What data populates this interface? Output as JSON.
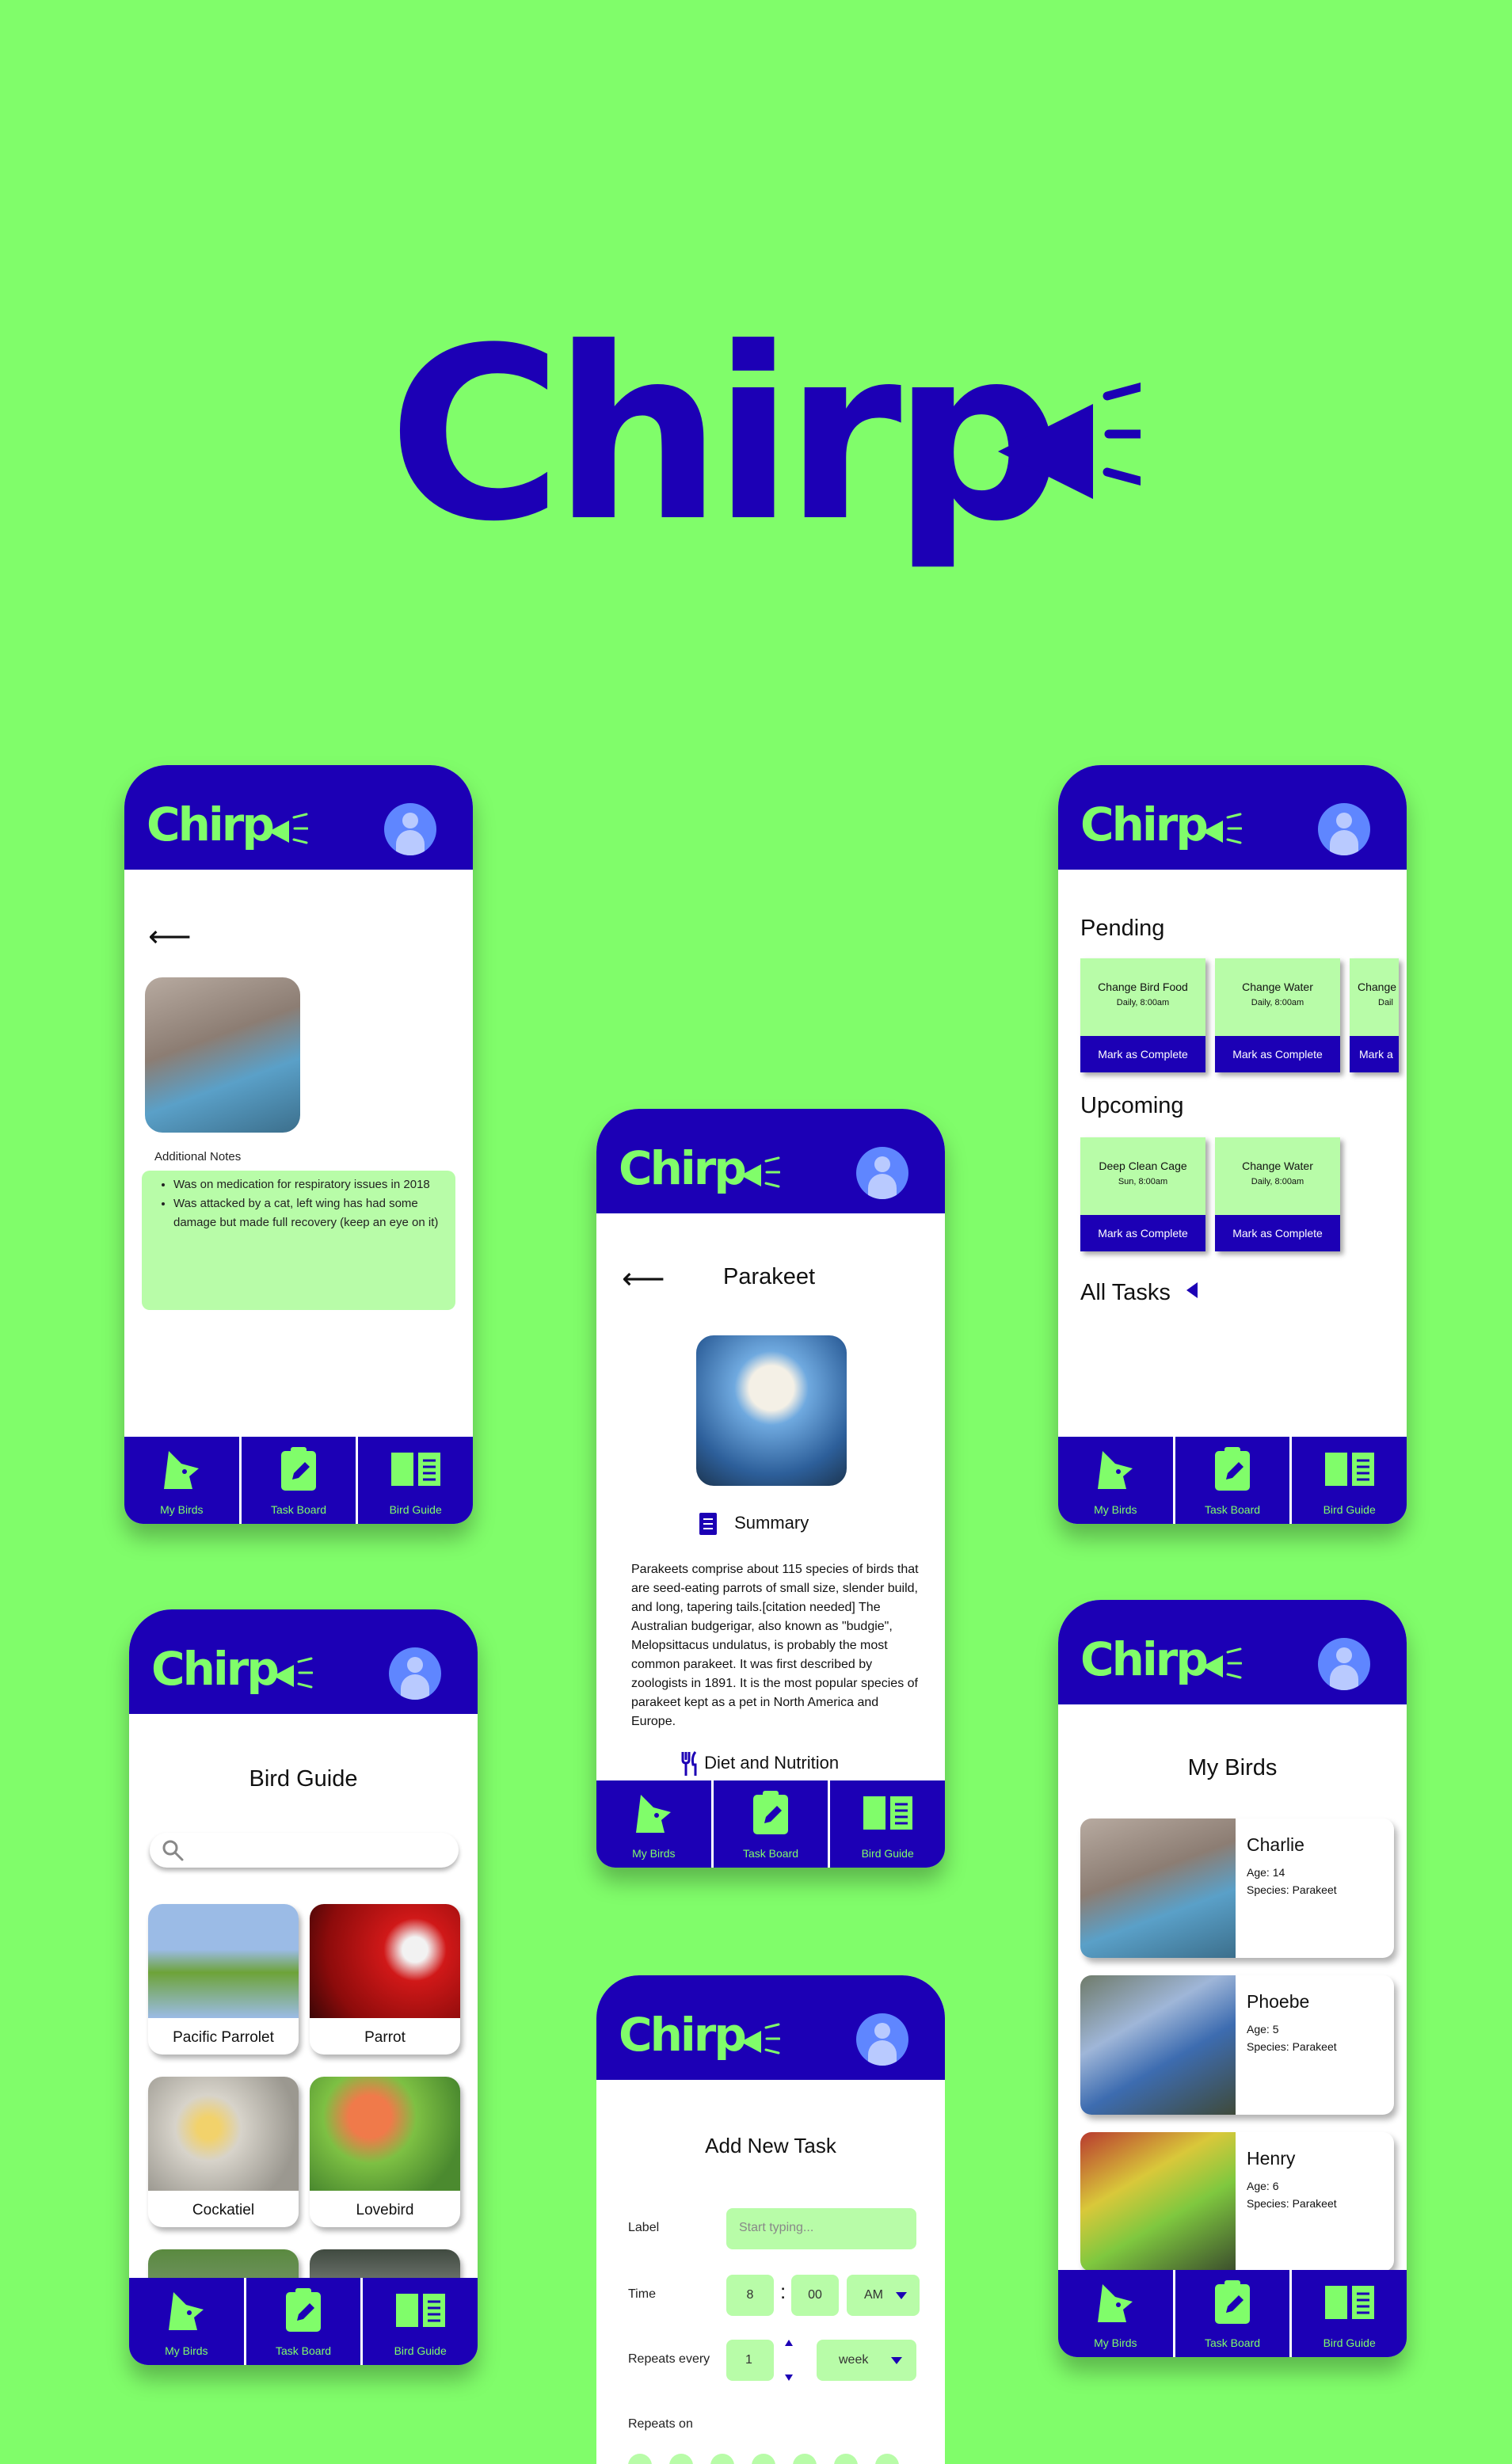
{
  "brand": {
    "name": "Chirp",
    "primary_color": "#1c00b5",
    "accent_color": "#80fd6a",
    "card_color": "#b8fca8"
  },
  "nav": {
    "my_birds": "My Birds",
    "task_board": "Task Board",
    "bird_guide": "Bird Guide"
  },
  "bird_detail": {
    "back_icon": "back-arrow-icon",
    "notes_title": "Additional Notes",
    "notes": [
      "Was on medication for respiratory issues in 2018",
      "Was attacked by a cat, left wing has had some damage but made full recovery (keep an eye on it)"
    ]
  },
  "task_board": {
    "pending_title": "Pending",
    "pending": [
      {
        "label": "Change Bird Food",
        "time": "Daily, 8:00am",
        "button": "Mark as Complete"
      },
      {
        "label": "Change Water",
        "time": "Daily, 8:00am",
        "button": "Mark as Complete"
      },
      {
        "label": "Change",
        "time": "Dail",
        "button": "Mark a"
      }
    ],
    "upcoming_title": "Upcoming",
    "upcoming": [
      {
        "label": "Deep Clean Cage",
        "time": "Sun, 8:00am",
        "button": "Mark as Complete"
      },
      {
        "label": "Change Water",
        "time": "Daily, 8:00am",
        "button": "Mark as Complete"
      }
    ],
    "all_tasks_label": "All Tasks"
  },
  "species_page": {
    "title": "Parakeet",
    "summary_title": "Summary",
    "summary_text": "Parakeets comprise about 115 species of birds that are seed-eating parrots of small size, slender build, and long, tapering tails.[citation needed] The Australian budgerigar, also known as \"budgie\", Melopsittacus undulatus, is probably the most common parakeet. It was first described by zoologists in 1891. It is the most popular species of parakeet kept as a pet in North America and Europe.",
    "diet_title": "Diet and Nutrition"
  },
  "bird_guide": {
    "title": "Bird Guide",
    "search_placeholder": "",
    "species": [
      "Pacific Parrolet",
      "Parrot",
      "Cockatiel",
      "Lovebird"
    ]
  },
  "my_birds": {
    "title": "My Birds",
    "birds": [
      {
        "name": "Charlie",
        "age": "Age: 14",
        "species": "Species: Parakeet"
      },
      {
        "name": "Phoebe",
        "age": "Age: 5",
        "species": "Species: Parakeet"
      },
      {
        "name": "Henry",
        "age": "Age: 6",
        "species": "Species: Parakeet"
      }
    ]
  },
  "add_task": {
    "title": "Add New Task",
    "label_label": "Label",
    "label_placeholder": "Start typing...",
    "time_label": "Time",
    "hour": "8",
    "minute": "00",
    "ampm": "AM",
    "repeats_every_label": "Repeats every",
    "repeat_count": "1",
    "repeat_unit": "week",
    "repeats_on_label": "Repeats on"
  }
}
